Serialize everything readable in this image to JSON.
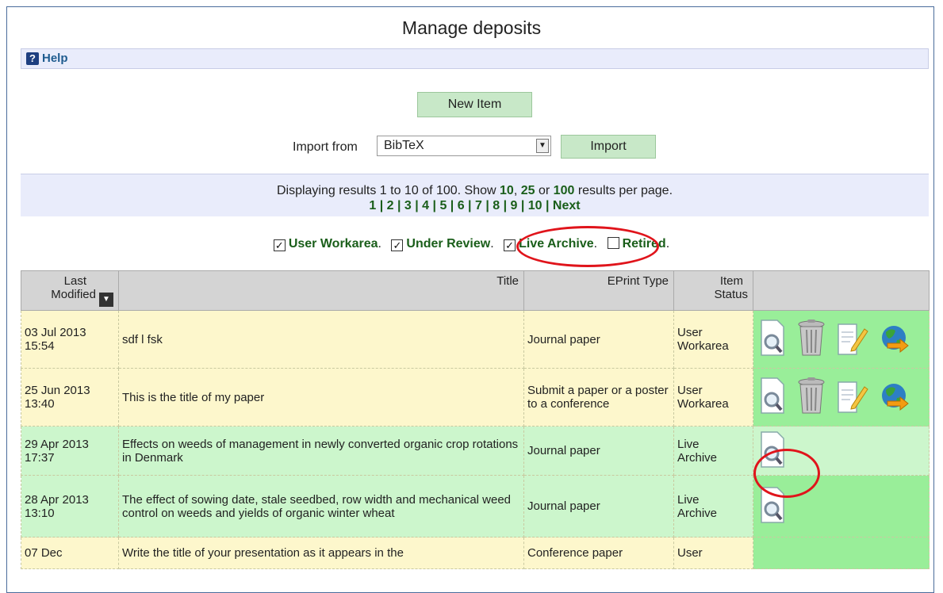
{
  "page": {
    "title": "Manage deposits"
  },
  "help": {
    "label": "Help"
  },
  "new_item": {
    "label": "New Item"
  },
  "import": {
    "label": "Import from",
    "selected": "BibTeX",
    "button": "Import"
  },
  "paging": {
    "text": "Displaying results 1 to 10 of 100. Show",
    "opt10": "10",
    "sep1": ",",
    "opt25": "25",
    "or": "or",
    "opt100": "100",
    "suffix": "results per page.",
    "pages": "1 | 2 | 3 | 4 | 5 | 6 | 7 | 8 | 9 | 10 | Next"
  },
  "filters": [
    {
      "label": "User Workarea",
      "checked": "✓"
    },
    {
      "label": "Under Review",
      "checked": "✓"
    },
    {
      "label": "Live Archive",
      "checked": "✓"
    },
    {
      "label": "Retired",
      "checked": ""
    }
  ],
  "columns": {
    "modified_line1": "Last",
    "modified_line2": "Modified",
    "title": "Title",
    "type": "EPrint Type",
    "status_line1": "Item",
    "status_line2": "Status"
  },
  "rows": [
    {
      "date": "03 Jul 2013",
      "time": "15:54",
      "title": "sdf l fsk",
      "type": "Journal paper",
      "status1": "User",
      "status2": "Workarea"
    },
    {
      "date": "25 Jun 2013",
      "time": "13:40",
      "title": "This is the title of my paper",
      "type": "Submit a paper or a poster to a conference",
      "status1": "User",
      "status2": "Workarea"
    },
    {
      "date": "29 Apr 2013",
      "time": "17:37",
      "title": "Effects on weeds of management in newly converted organic crop rotations in Denmark",
      "type": "Journal paper",
      "status1": "Live",
      "status2": "Archive"
    },
    {
      "date": "28 Apr 2013",
      "time": "13:10",
      "title": "The effect of sowing date, stale seedbed, row width and mechanical weed control on weeds and yields of organic winter wheat",
      "type": "Journal paper",
      "status1": "Live",
      "status2": "Archive"
    },
    {
      "date": "07 Dec",
      "time": "",
      "title": "Write the title of your presentation as it appears in the",
      "type": "Conference paper",
      "status1": "User",
      "status2": ""
    }
  ],
  "colors": {
    "accent_green": "#1a5e1a",
    "row_yellow": "#fdf7cc",
    "row_green": "#ccf6cc",
    "highlight": "#e0141b"
  }
}
